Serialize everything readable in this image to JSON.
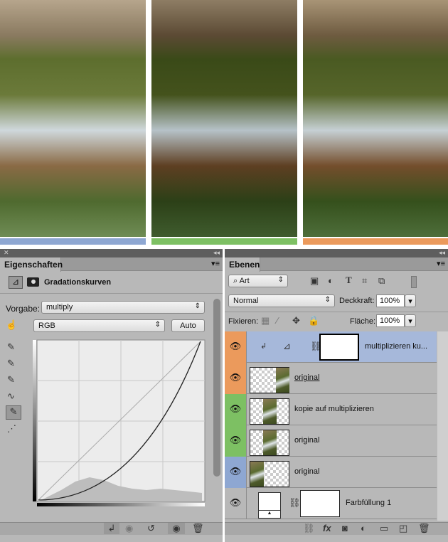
{
  "photos": {
    "bar_colors": [
      "#8ea7d2",
      "#7dc063",
      "#eb9a5c"
    ]
  },
  "properties": {
    "tab": "Eigenschaften",
    "title": "Gradationskurven",
    "preset_label": "Vorgabe:",
    "preset_value": "multiply",
    "channel_value": "RGB",
    "auto_label": "Auto"
  },
  "layers": {
    "tab": "Ebenen",
    "filter_value": "Art",
    "blend_mode": "Normal",
    "opacity_label": "Deckkraft:",
    "opacity_value": "100%",
    "lock_label": "Fixieren:",
    "fill_label": "Fläche:",
    "fill_value": "100%",
    "items": [
      {
        "name": "multiplizieren ku...",
        "color": "#eb9a5c",
        "selected": true
      },
      {
        "name": "original",
        "color": "#eb9a5c"
      },
      {
        "name": "kopie auf multiplizieren",
        "color": "#7dc063"
      },
      {
        "name": "original",
        "color": "#7dc063"
      },
      {
        "name": "original",
        "color": "#8ea7d2"
      },
      {
        "name": "Farbfüllung 1",
        "color": ""
      }
    ]
  }
}
